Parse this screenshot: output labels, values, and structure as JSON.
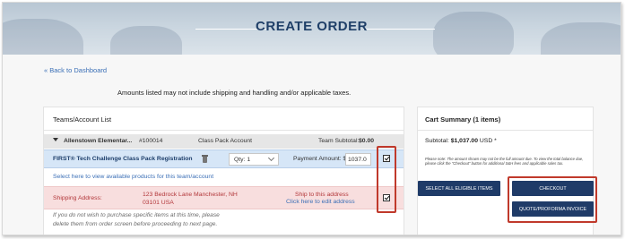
{
  "header": {
    "title": "CREATE ORDER"
  },
  "nav": {
    "back_label": "« Back to Dashboard"
  },
  "notice": {
    "disclaimer": "Amounts listed may not include shipping and handling and/or applicable taxes."
  },
  "teams_panel": {
    "title": "Teams/Account List",
    "account_row": {
      "team_name": "Allenstown Elementar...",
      "team_number": "#100014",
      "account_type": "Class Pack Account",
      "subtotal_label": "Team Subtotal:",
      "subtotal_value": "$0.00"
    },
    "pack_row": {
      "product_name": "FIRST® Tech Challenge Class Pack Registration",
      "qty_value": "Qty: 1",
      "payment_label": "Payment Amount: $",
      "payment_value": "1037.0",
      "checked": true
    },
    "view_products_link": "Select here to view available products for this team/account",
    "shipping": {
      "label": "Shipping Address:",
      "address_line1": "123 Bedrock Lane Manchester, NH",
      "address_line2": "03101 USA",
      "ship_to_label": "Ship to this address",
      "edit_link": "Click here to edit address",
      "checked": true
    },
    "removal_note": "If you do not wish to purchase specific items at this time, please delete them from order screen before proceeding to next page."
  },
  "cart": {
    "title": "Cart Summary (1 items)",
    "subtotal_label": "Subtotal:",
    "subtotal_value": "$1,037.00",
    "subtotal_currency": "USD *",
    "fine_print": "Please note: The amount shown may not be the full amount due. To view the total balance due, please click the \"Checkout\" button for additional S&H fees and applicable sales tax.",
    "select_all_label": "SELECT ALL ELIGIBLE ITEMS",
    "checkout_label": "CHECKOUT",
    "quote_label": "QUOTE/PROFORMA INVOICE"
  },
  "colors": {
    "brand_navy": "#1f3b68",
    "title_blue": "#1f3f68",
    "link_blue": "#3b6fb6",
    "highlight_blue": "#d6e6f7",
    "shipping_pink": "#f8dede",
    "shipping_red": "#b2373a",
    "callout_red": "#c0392b"
  }
}
